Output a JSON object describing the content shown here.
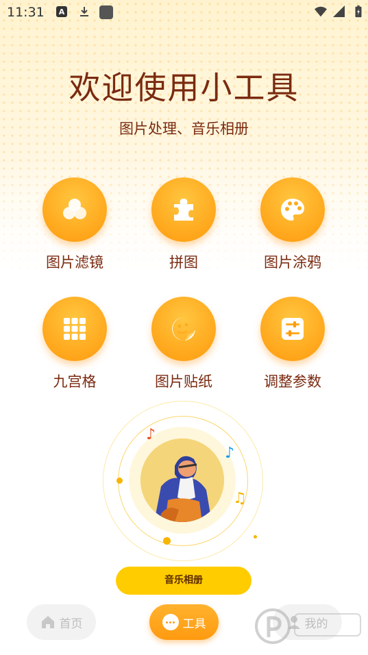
{
  "status_bar": {
    "time": "11:31",
    "icons": [
      "a-icon",
      "download-icon",
      "app-square-icon",
      "wifi-icon",
      "signal-icon",
      "battery-charging-icon"
    ],
    "a_glyph": "A"
  },
  "header": {
    "title": "欢迎使用小工具",
    "subtitle": "图片处理、音乐相册"
  },
  "tools": [
    {
      "label": "图片滤镜",
      "icon": "bubbles-icon"
    },
    {
      "label": "拼图",
      "icon": "puzzle-icon"
    },
    {
      "label": "图片涂鸦",
      "icon": "palette-icon"
    },
    {
      "label": "九宫格",
      "icon": "grid-icon"
    },
    {
      "label": "图片贴纸",
      "icon": "sticker-icon"
    },
    {
      "label": "调整参数",
      "icon": "sliders-icon"
    }
  ],
  "music": {
    "button_label": "音乐相册"
  },
  "bottom_nav": {
    "home": "首页",
    "tools": "工具",
    "mine": "我的"
  },
  "colors": {
    "accent": "#ffab20",
    "title_text": "#7a2a10",
    "album_button": "#ffcc00"
  }
}
